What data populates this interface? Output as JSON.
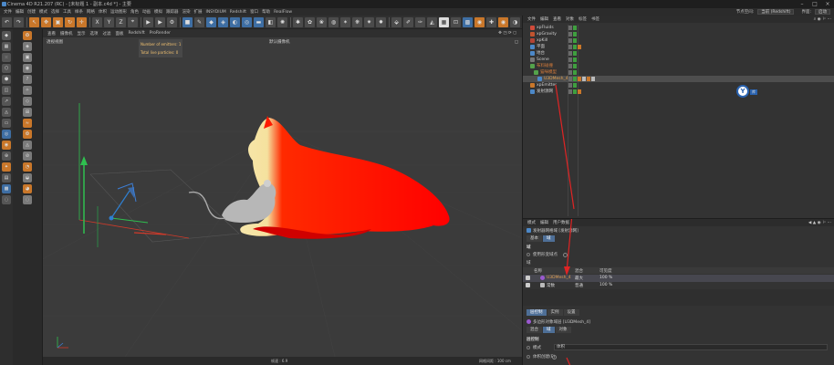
{
  "window": {
    "title": "Cinema 4D R21.207 (RC) - [未标题 1 - 副本.c4d *] - 主要"
  },
  "menubar": {
    "items": [
      "文件",
      "编辑",
      "创建",
      "模式",
      "选择",
      "工具",
      "样条",
      "网格",
      "体积",
      "运动图形",
      "角色",
      "动画",
      "模拟",
      "跟踪器",
      "渲染",
      "扩展",
      "INSYDIUM",
      "Redshift",
      "窗口",
      "帮助",
      "RealFlow"
    ],
    "node_space_label": "节点空间:",
    "node_space_value": "当前 (Redshift)",
    "layout_label": "界面:",
    "layout_value": "启动"
  },
  "toolbar": {
    "xyz": [
      "X",
      "Y",
      "Z"
    ]
  },
  "viewport": {
    "menu": [
      "查看",
      "摄像机",
      "显示",
      "选项",
      "过滤",
      "面板",
      "Redshift",
      "ProRender"
    ],
    "view_name": "透视视图",
    "camera_label": "默认摄像机",
    "hud": {
      "emitters_line": "Number of emitters: 1",
      "particles_line": "Total live particles: 0"
    },
    "status_speed": "帧速 : 6.9",
    "status_grid": "网格间距 : 100 cm"
  },
  "object_manager": {
    "menu": [
      "文件",
      "编辑",
      "查看",
      "对象",
      "标签",
      "书签"
    ],
    "rows": [
      {
        "name": "xpFluids",
        "color": "#d24b3a"
      },
      {
        "name": "xpGravity",
        "color": "#c0542f"
      },
      {
        "name": "xpKill",
        "color": "#b34435"
      },
      {
        "name": "平面",
        "color": "#4c88c8"
      },
      {
        "name": "地台",
        "color": "#4c88c8"
      },
      {
        "name": "Scene",
        "color": "#777777"
      },
      {
        "name": "布料碰撞",
        "color": "#54a24b"
      },
      {
        "name": "猫咪模型",
        "color": "#54a24b"
      },
      {
        "name": "U3DMesh_4",
        "color": "#4c88c8"
      },
      {
        "name": "xpEmitter",
        "color": "#c9772a"
      },
      {
        "name": "发射源网",
        "color": "#4c88c8"
      }
    ]
  },
  "attribute_manager": {
    "menu": [
      "模式",
      "编辑",
      "用户数据"
    ],
    "title": "发射器网格域 [发射源网]",
    "tabs": [
      "基本",
      "域"
    ],
    "section": "域",
    "option_label": "使用形变域点",
    "sub_label": "域",
    "columns": [
      "名称",
      "混合",
      "可见度"
    ],
    "layers": [
      {
        "name": "U3DMesh_4",
        "blend": "最大",
        "opacity": "100 %"
      },
      {
        "name": "常数",
        "blend": "普通",
        "opacity": "100 %"
      }
    ],
    "bottom_tabs": [
      "层控制",
      "实例",
      "设置"
    ],
    "bottom_title": "多边形对象域层 [U3DMesh_4]",
    "bottom_sub_tabs": [
      "混合",
      "域",
      "对象"
    ],
    "bottom_section": "层控制",
    "mode_label": "模式",
    "mode_value": "体积",
    "last_option": "体积创建(F)"
  },
  "colors": {
    "accent_orange": "#c9772a",
    "accent_blue": "#3e6ea3",
    "cat_red": "#ff0000",
    "cat_yellow": "#f5e2a0",
    "annotation_red": "#e02424"
  },
  "badge": {
    "letter": "Y",
    "caption": "库"
  }
}
